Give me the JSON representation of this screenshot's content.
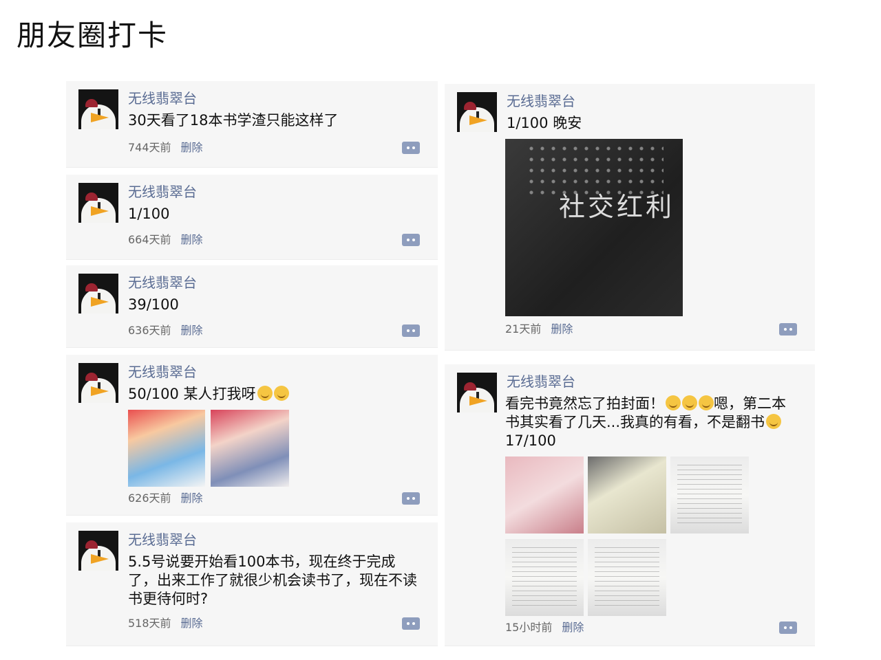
{
  "page": {
    "title": "朋友圈打卡"
  },
  "posts_left": [
    {
      "author": "无线翡翠台",
      "text": "30天看了18本书学渣只能这样了",
      "time": "744天前",
      "delete_label": "删除"
    },
    {
      "author": "无线翡翠台",
      "text": "1/100",
      "time": "664天前",
      "delete_label": "删除"
    },
    {
      "author": "无线翡翠台",
      "text": "39/100",
      "time": "636天前",
      "delete_label": "删除"
    },
    {
      "author": "无线翡翠台",
      "text": "50/100 某人打我呀",
      "emoji_count": 2,
      "time": "626天前",
      "delete_label": "删除",
      "images": [
        "manga-cover-1",
        "manga-cover-2"
      ]
    },
    {
      "author": "无线翡翠台",
      "text": "5.5号说要开始看100本书，现在终于完成了，出来工作了就很少机会读书了，现在不读书更待何时?",
      "time": "518天前",
      "delete_label": "删除"
    }
  ],
  "posts_right": [
    {
      "author": "无线翡翠台",
      "text": "1/100 晚安",
      "image_title": "社交红利",
      "time": "21天前",
      "delete_label": "删除"
    },
    {
      "author": "无线翡翠台",
      "text_line1": "看完书竟然忘了拍封面！",
      "text_line1b": "嗯，第二本",
      "text_line2": "书其实看了几天...我真的有看，不是翻书",
      "text_line3": "17/100",
      "time": "15小时前",
      "delete_label": "删除",
      "images": [
        "book-pink",
        "book-design",
        "page",
        "page",
        "page"
      ]
    }
  ],
  "icons": {
    "comment": "comment-icon",
    "avatar": "avatar-bird-icon",
    "emoji": "smile-emoji-icon"
  },
  "colors": {
    "author": "#5a6c93",
    "card_bg": "#f6f6f6",
    "comment_button": "#8e9dbd"
  }
}
